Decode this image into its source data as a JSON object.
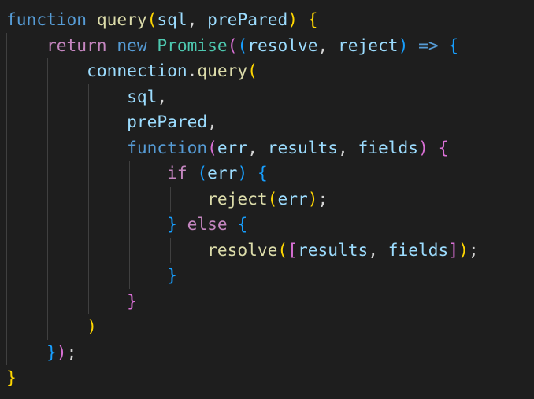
{
  "editor": {
    "theme_colors": {
      "background": "#1e1e1e",
      "keyword": "#569cd6",
      "control_keyword": "#c586c0",
      "function_name": "#dcdcaa",
      "variable": "#9cdcfe",
      "class_name": "#4ec9b0",
      "punctuation": "#d4d4d4",
      "bracket_level_1": "#ffd700",
      "bracket_level_2": "#da70d6",
      "bracket_level_3": "#179fff",
      "indent_guide": "#404040"
    },
    "lines": [
      [
        {
          "t": "function",
          "c": "kw"
        },
        {
          "t": " ",
          "c": "pn"
        },
        {
          "t": "query",
          "c": "fn"
        },
        {
          "t": "(",
          "c": "b1"
        },
        {
          "t": "sql",
          "c": "var"
        },
        {
          "t": ", ",
          "c": "pn"
        },
        {
          "t": "prePared",
          "c": "var"
        },
        {
          "t": ")",
          "c": "b1"
        },
        {
          "t": " ",
          "c": "pn"
        },
        {
          "t": "{",
          "c": "b1"
        }
      ],
      [
        {
          "t": "    ",
          "c": "pn"
        },
        {
          "t": "return",
          "c": "ctl"
        },
        {
          "t": " ",
          "c": "pn"
        },
        {
          "t": "new",
          "c": "kw"
        },
        {
          "t": " ",
          "c": "pn"
        },
        {
          "t": "Promise",
          "c": "cls"
        },
        {
          "t": "(",
          "c": "b2"
        },
        {
          "t": "(",
          "c": "b3"
        },
        {
          "t": "resolve",
          "c": "var"
        },
        {
          "t": ", ",
          "c": "pn"
        },
        {
          "t": "reject",
          "c": "var"
        },
        {
          "t": ")",
          "c": "b3"
        },
        {
          "t": " ",
          "c": "pn"
        },
        {
          "t": "=>",
          "c": "kw"
        },
        {
          "t": " ",
          "c": "pn"
        },
        {
          "t": "{",
          "c": "b3"
        }
      ],
      [
        {
          "t": "        ",
          "c": "pn"
        },
        {
          "t": "connection",
          "c": "var"
        },
        {
          "t": ".",
          "c": "pn"
        },
        {
          "t": "query",
          "c": "fn"
        },
        {
          "t": "(",
          "c": "b1"
        }
      ],
      [
        {
          "t": "            ",
          "c": "pn"
        },
        {
          "t": "sql",
          "c": "var"
        },
        {
          "t": ",",
          "c": "pn"
        }
      ],
      [
        {
          "t": "            ",
          "c": "pn"
        },
        {
          "t": "prePared",
          "c": "var"
        },
        {
          "t": ",",
          "c": "pn"
        }
      ],
      [
        {
          "t": "            ",
          "c": "pn"
        },
        {
          "t": "function",
          "c": "kw"
        },
        {
          "t": "(",
          "c": "b2"
        },
        {
          "t": "err",
          "c": "var"
        },
        {
          "t": ", ",
          "c": "pn"
        },
        {
          "t": "results",
          "c": "var"
        },
        {
          "t": ", ",
          "c": "pn"
        },
        {
          "t": "fields",
          "c": "var"
        },
        {
          "t": ")",
          "c": "b2"
        },
        {
          "t": " ",
          "c": "pn"
        },
        {
          "t": "{",
          "c": "b2"
        }
      ],
      [
        {
          "t": "                ",
          "c": "pn"
        },
        {
          "t": "if",
          "c": "ctl"
        },
        {
          "t": " ",
          "c": "pn"
        },
        {
          "t": "(",
          "c": "b3"
        },
        {
          "t": "err",
          "c": "var"
        },
        {
          "t": ")",
          "c": "b3"
        },
        {
          "t": " ",
          "c": "pn"
        },
        {
          "t": "{",
          "c": "b3"
        }
      ],
      [
        {
          "t": "                    ",
          "c": "pn"
        },
        {
          "t": "reject",
          "c": "fn"
        },
        {
          "t": "(",
          "c": "b1"
        },
        {
          "t": "err",
          "c": "var"
        },
        {
          "t": ")",
          "c": "b1"
        },
        {
          "t": ";",
          "c": "pn"
        }
      ],
      [
        {
          "t": "                ",
          "c": "pn"
        },
        {
          "t": "}",
          "c": "b3"
        },
        {
          "t": " ",
          "c": "pn"
        },
        {
          "t": "else",
          "c": "ctl"
        },
        {
          "t": " ",
          "c": "pn"
        },
        {
          "t": "{",
          "c": "b3"
        }
      ],
      [
        {
          "t": "                    ",
          "c": "pn"
        },
        {
          "t": "resolve",
          "c": "fn"
        },
        {
          "t": "(",
          "c": "b1"
        },
        {
          "t": "[",
          "c": "b2"
        },
        {
          "t": "results",
          "c": "var"
        },
        {
          "t": ", ",
          "c": "pn"
        },
        {
          "t": "fields",
          "c": "var"
        },
        {
          "t": "]",
          "c": "b2"
        },
        {
          "t": ")",
          "c": "b1"
        },
        {
          "t": ";",
          "c": "pn"
        }
      ],
      [
        {
          "t": "                ",
          "c": "pn"
        },
        {
          "t": "}",
          "c": "b3"
        }
      ],
      [
        {
          "t": "            ",
          "c": "pn"
        },
        {
          "t": "}",
          "c": "b2"
        }
      ],
      [
        {
          "t": "        ",
          "c": "pn"
        },
        {
          "t": ")",
          "c": "b1"
        }
      ],
      [
        {
          "t": "    ",
          "c": "pn"
        },
        {
          "t": "}",
          "c": "b3"
        },
        {
          "t": ")",
          "c": "b2"
        },
        {
          "t": ";",
          "c": "pn"
        }
      ],
      [
        {
          "t": "}",
          "c": "b1"
        }
      ]
    ]
  }
}
